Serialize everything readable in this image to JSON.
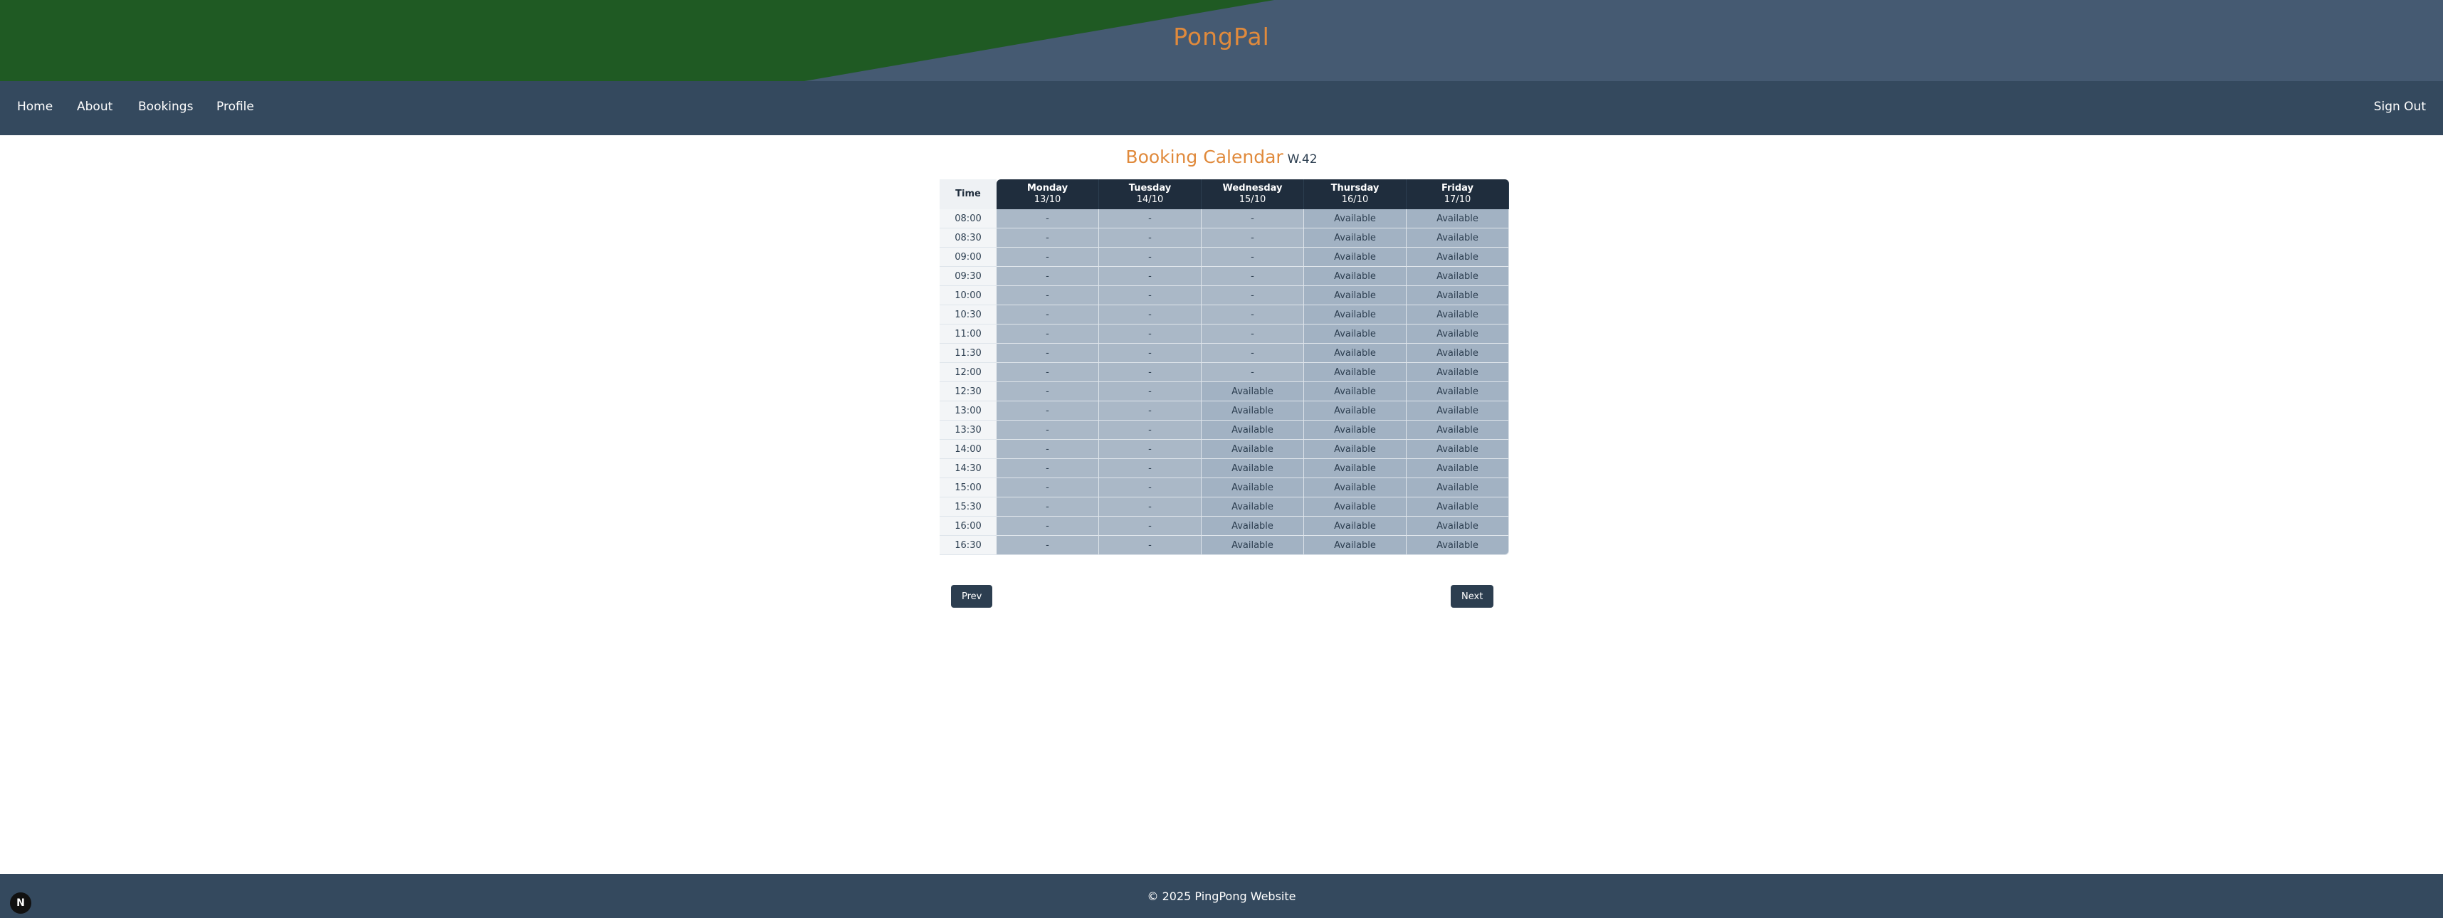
{
  "brand": "PongPal",
  "nav": {
    "items": [
      "Home",
      "About",
      "Bookings",
      "Profile"
    ],
    "sign_out": "Sign Out"
  },
  "calendar": {
    "title": "Booking Calendar",
    "week": "W.42",
    "time_header": "Time",
    "days": [
      {
        "name": "Monday",
        "date": "13/10"
      },
      {
        "name": "Tuesday",
        "date": "14/10"
      },
      {
        "name": "Wednesday",
        "date": "15/10"
      },
      {
        "name": "Thursday",
        "date": "16/10"
      },
      {
        "name": "Friday",
        "date": "17/10"
      }
    ],
    "rows": [
      {
        "time": "08:00",
        "cells": [
          "-",
          "-",
          "-",
          "Available",
          "Available"
        ]
      },
      {
        "time": "08:30",
        "cells": [
          "-",
          "-",
          "-",
          "Available",
          "Available"
        ]
      },
      {
        "time": "09:00",
        "cells": [
          "-",
          "-",
          "-",
          "Available",
          "Available"
        ]
      },
      {
        "time": "09:30",
        "cells": [
          "-",
          "-",
          "-",
          "Available",
          "Available"
        ]
      },
      {
        "time": "10:00",
        "cells": [
          "-",
          "-",
          "-",
          "Available",
          "Available"
        ]
      },
      {
        "time": "10:30",
        "cells": [
          "-",
          "-",
          "-",
          "Available",
          "Available"
        ]
      },
      {
        "time": "11:00",
        "cells": [
          "-",
          "-",
          "-",
          "Available",
          "Available"
        ]
      },
      {
        "time": "11:30",
        "cells": [
          "-",
          "-",
          "-",
          "Available",
          "Available"
        ]
      },
      {
        "time": "12:00",
        "cells": [
          "-",
          "-",
          "-",
          "Available",
          "Available"
        ]
      },
      {
        "time": "12:30",
        "cells": [
          "-",
          "-",
          "Available",
          "Available",
          "Available"
        ]
      },
      {
        "time": "13:00",
        "cells": [
          "-",
          "-",
          "Available",
          "Available",
          "Available"
        ]
      },
      {
        "time": "13:30",
        "cells": [
          "-",
          "-",
          "Available",
          "Available",
          "Available"
        ]
      },
      {
        "time": "14:00",
        "cells": [
          "-",
          "-",
          "Available",
          "Available",
          "Available"
        ]
      },
      {
        "time": "14:30",
        "cells": [
          "-",
          "-",
          "Available",
          "Available",
          "Available"
        ]
      },
      {
        "time": "15:00",
        "cells": [
          "-",
          "-",
          "Available",
          "Available",
          "Available"
        ]
      },
      {
        "time": "15:30",
        "cells": [
          "-",
          "-",
          "Available",
          "Available",
          "Available"
        ]
      },
      {
        "time": "16:00",
        "cells": [
          "-",
          "-",
          "Available",
          "Available",
          "Available"
        ]
      },
      {
        "time": "16:30",
        "cells": [
          "-",
          "-",
          "Available",
          "Available",
          "Available"
        ]
      }
    ]
  },
  "pager": {
    "prev": "Prev",
    "next": "Next"
  },
  "footer": {
    "text": "© 2025 PingPong Website"
  },
  "badge": {
    "label": "N"
  },
  "colors": {
    "accent": "#e08a3c",
    "header_green": "#1f5a23",
    "header_blue": "#455a72",
    "nav": "#34495e",
    "table_head": "#1f2d3d",
    "slot": "#a2b2c3"
  }
}
